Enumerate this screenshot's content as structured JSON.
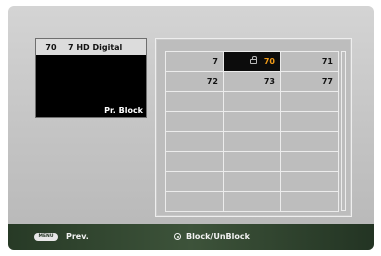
{
  "preview": {
    "channel_number": "70",
    "channel_name": "7 HD Digital",
    "status": "Pr. Block"
  },
  "channel_grid": {
    "columns": 3,
    "rows": 8,
    "cells": [
      [
        "7",
        "70",
        "71"
      ],
      [
        "72",
        "73",
        "77"
      ],
      [
        "",
        "",
        ""
      ],
      [
        "",
        "",
        ""
      ],
      [
        "",
        "",
        ""
      ],
      [
        "",
        "",
        ""
      ],
      [
        "",
        "",
        ""
      ],
      [
        "",
        "",
        ""
      ]
    ],
    "selected": "70",
    "selected_icon": "lock-icon"
  },
  "footer": {
    "menu_key": "MENU",
    "prev_label": "Prev.",
    "enter_icon": "enter-icon",
    "block_label": "Block/UnBlock"
  },
  "colors": {
    "selected_text": "#f09b1a",
    "selected_bg": "#0c0c0c",
    "footer_bg": "#3d533a"
  }
}
